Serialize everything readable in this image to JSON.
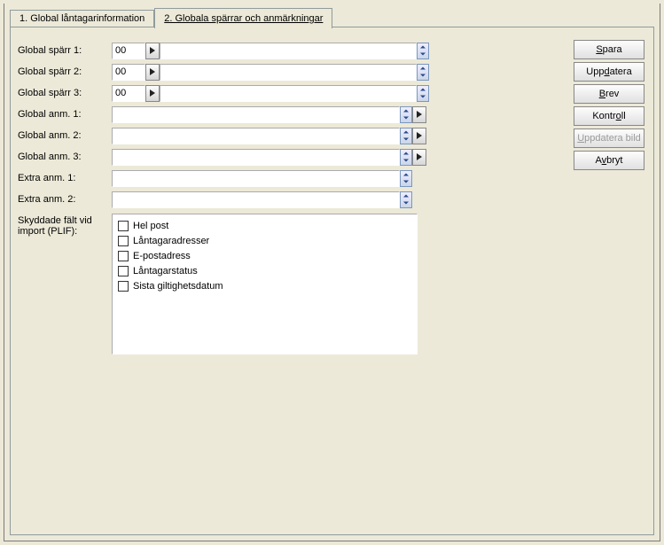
{
  "tabs": [
    {
      "label": "1. Global låntagarinformation"
    },
    {
      "label": "2. Globala spärrar och anmärkningar"
    }
  ],
  "fields": {
    "gsp1": {
      "label": "Global spärr 1:",
      "code": "00",
      "desc": ""
    },
    "gsp2": {
      "label": "Global spärr 2:",
      "code": "00",
      "desc": ""
    },
    "gsp3": {
      "label": "Global spärr 3:",
      "code": "00",
      "desc": ""
    },
    "ga1": {
      "label": "Global anm. 1:",
      "value": ""
    },
    "ga2": {
      "label": "Global anm. 2:",
      "value": ""
    },
    "ga3": {
      "label": "Global anm. 3:",
      "value": ""
    },
    "ea1": {
      "label": "Extra anm. 1:",
      "value": ""
    },
    "ea2": {
      "label": "Extra anm. 2:",
      "value": ""
    }
  },
  "protect": {
    "label": "Skyddade fält vid import (PLIF):",
    "items": [
      "Hel post",
      "Låntagaradresser",
      "E-postadress",
      "Låntagarstatus",
      "Sista giltighetsdatum"
    ]
  },
  "buttons": {
    "save": {
      "pre": "",
      "u": "S",
      "post": "para"
    },
    "update": {
      "pre": "Upp",
      "u": "d",
      "post": "atera"
    },
    "letter": {
      "pre": "",
      "u": "B",
      "post": "rev"
    },
    "control": {
      "pre": "Kontr",
      "u": "o",
      "post": "ll"
    },
    "updimg": {
      "pre": "",
      "u": "U",
      "post": "ppdatera bild"
    },
    "cancel": {
      "pre": "A",
      "u": "v",
      "post": "bryt"
    }
  }
}
